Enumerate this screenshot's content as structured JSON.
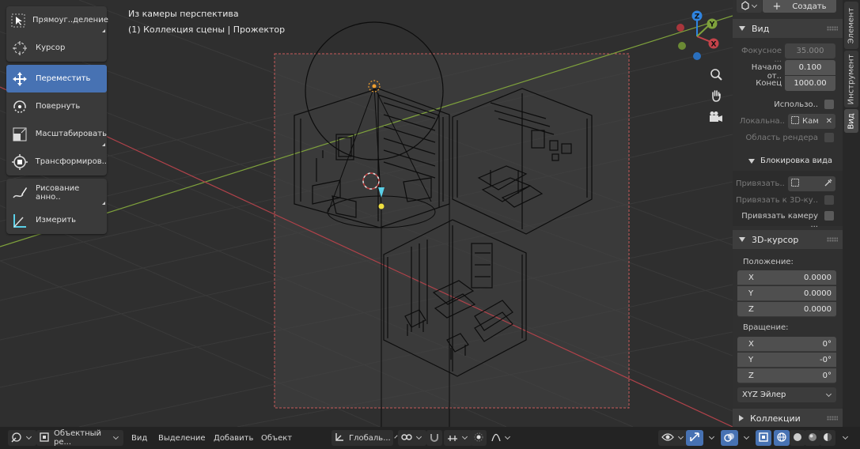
{
  "viewport": {
    "view_title": "Из камеры перспектива",
    "collection_label": "(1) Коллекция сцены | Прожектор"
  },
  "toolbar": {
    "groups": [
      [
        {
          "label": "Прямоуг..деление",
          "icon": "select-box-icon"
        },
        {
          "label": "Курсор",
          "icon": "cursor-icon"
        }
      ],
      [
        {
          "label": "Переместить",
          "icon": "move-icon",
          "active": true
        },
        {
          "label": "Повернуть",
          "icon": "rotate-icon"
        },
        {
          "label": "Масштабировать",
          "icon": "scale-icon"
        },
        {
          "label": "Трансформиров..",
          "icon": "transform-icon"
        }
      ],
      [
        {
          "label": "Рисование анно..",
          "icon": "annotate-icon"
        },
        {
          "label": "Измерить",
          "icon": "measure-icon"
        }
      ]
    ]
  },
  "gizmo": {
    "z": "Z",
    "y": "Y",
    "x": "X"
  },
  "sidebar": {
    "create_button": "Создать",
    "tabs": {
      "item": "Элемент",
      "tool": "Инструмент",
      "view": "Вид"
    },
    "view_panel": {
      "title": "Вид",
      "focal_label": "Фокусное ...",
      "focal_value": "35.000",
      "clip_start_label": "Начало от..",
      "clip_start_value": "0.100",
      "clip_end_label": "Конец",
      "clip_end_value": "1000.00",
      "use_local_label": "Использо..",
      "local_camera_label": "Локальна..",
      "local_camera_value": "Кам",
      "render_region_label": "Область рендера",
      "lock_title": "Блокировка вида",
      "lock_to_label": "Привязать..",
      "lock_cursor_label": "Привязать к 3D-ку..",
      "lock_camera_label": "Привязать камеру ..."
    },
    "cursor_panel": {
      "title": "3D-курсор",
      "location_label": "Положение:",
      "location": [
        {
          "axis": "X",
          "value": "0.0000"
        },
        {
          "axis": "Y",
          "value": "0.0000"
        },
        {
          "axis": "Z",
          "value": "0.0000"
        }
      ],
      "rotation_label": "Вращение:",
      "rotation": [
        {
          "axis": "X",
          "value": "0°"
        },
        {
          "axis": "Y",
          "value": "-0°"
        },
        {
          "axis": "Z",
          "value": "0°"
        }
      ],
      "rotation_mode": "XYZ Эйлер"
    },
    "collections_title": "Коллекции"
  },
  "header": {
    "mode": "Объектный ре...",
    "menu": [
      "Вид",
      "Выделение",
      "Добавить",
      "Объект"
    ],
    "orientation": "Глобаль..."
  },
  "colors": {
    "accent": "#4772b3",
    "axis_x": "#c4434a",
    "axis_y": "#7fa23c",
    "axis_z": "#2f84e0"
  }
}
